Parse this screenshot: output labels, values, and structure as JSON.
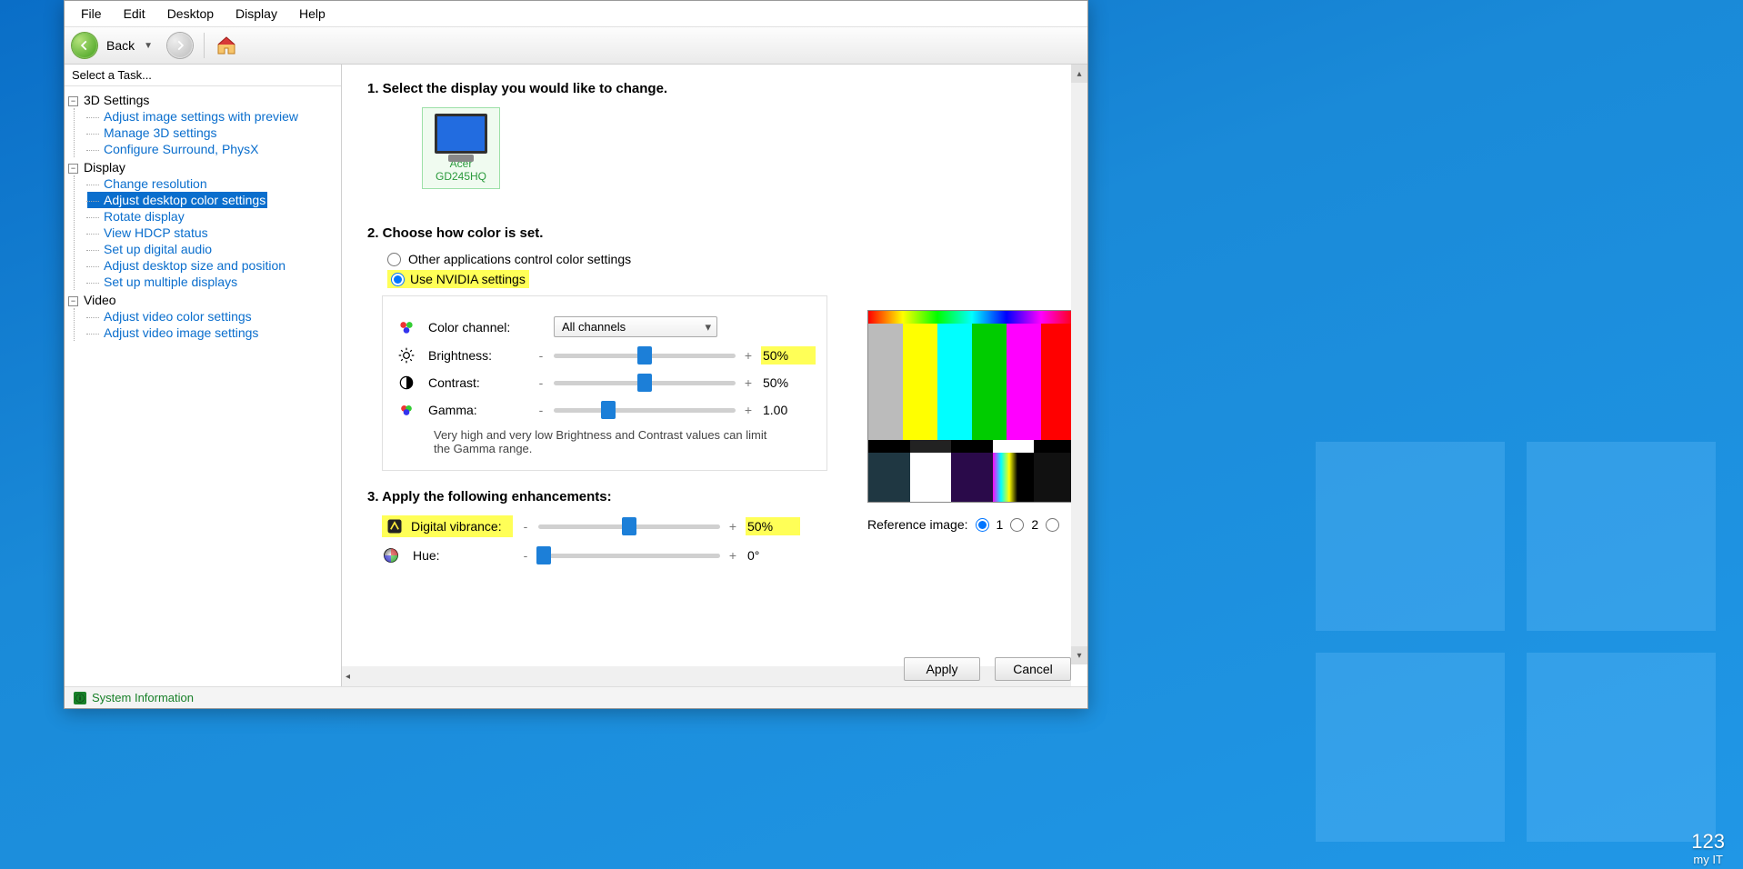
{
  "menubar": {
    "file": "File",
    "edit": "Edit",
    "desktop": "Desktop",
    "display": "Display",
    "help": "Help"
  },
  "toolbar": {
    "back": "Back"
  },
  "sidebar": {
    "header": "Select a Task...",
    "groups": [
      {
        "label": "3D Settings",
        "items": [
          "Adjust image settings with preview",
          "Manage 3D settings",
          "Configure Surround, PhysX"
        ]
      },
      {
        "label": "Display",
        "items": [
          "Change resolution",
          "Adjust desktop color settings",
          "Rotate display",
          "View HDCP status",
          "Set up digital audio",
          "Adjust desktop size and position",
          "Set up multiple displays"
        ],
        "selected": 1
      },
      {
        "label": "Video",
        "items": [
          "Adjust video color settings",
          "Adjust video image settings"
        ]
      }
    ]
  },
  "section1": {
    "title": "1. Select the display you would like to change.",
    "monitor": "Acer GD245HQ"
  },
  "section2": {
    "title": "2. Choose how color is set.",
    "opt_other": "Other applications control color settings",
    "opt_nvidia": "Use NVIDIA settings",
    "color_channel_label": "Color channel:",
    "color_channel_value": "All channels",
    "brightness_label": "Brightness:",
    "brightness_value": "50%",
    "brightness_pct": 50,
    "contrast_label": "Contrast:",
    "contrast_value": "50%",
    "contrast_pct": 50,
    "gamma_label": "Gamma:",
    "gamma_value": "1.00",
    "gamma_pct": 30,
    "gamma_note": "Very high and very low Brightness and Contrast values can limit the Gamma range."
  },
  "section3": {
    "title": "3. Apply the following enhancements:",
    "vibrance_label": "Digital vibrance:",
    "vibrance_value": "50%",
    "vibrance_pct": 50,
    "hue_label": "Hue:",
    "hue_value": "0°",
    "hue_pct": 3
  },
  "reference": {
    "label": "Reference image:",
    "opt1": "1",
    "opt2": "2"
  },
  "footer": {
    "sysinfo": "System Information",
    "apply": "Apply",
    "cancel": "Cancel"
  },
  "watermark": {
    "num": "123",
    "txt": "my IT"
  }
}
